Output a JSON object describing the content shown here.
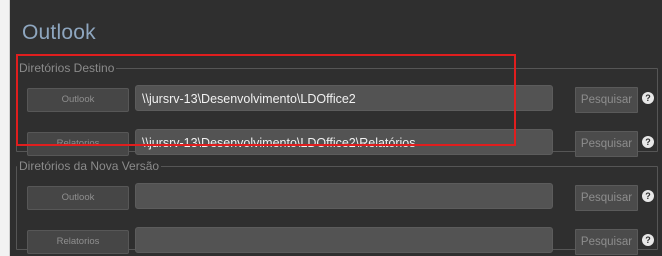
{
  "title": "Outlook",
  "sections": [
    {
      "legend": "Diretórios Destino",
      "rows": [
        {
          "button": "Outlook",
          "path": "\\\\jursrv-13\\Desenvolvimento\\LDOffice2",
          "search": "Pesquisar",
          "help": "?"
        },
        {
          "button": "Relatorios",
          "path": "\\\\jursrv-13\\Desenvolvimento\\LDOffice2\\Relatórios",
          "search": "Pesquisar",
          "help": "?"
        }
      ]
    },
    {
      "legend": "Diretórios da Nova Versão",
      "rows": [
        {
          "button": "Outlook",
          "path": "",
          "search": "Pesquisar",
          "help": "?"
        },
        {
          "button": "Relatorios",
          "path": "",
          "search": "Pesquisar",
          "help": "?"
        }
      ]
    }
  ],
  "colors": {
    "panel": "#2f2f2f",
    "title": "#8ea6bf",
    "highlight": "#e01e1e"
  }
}
